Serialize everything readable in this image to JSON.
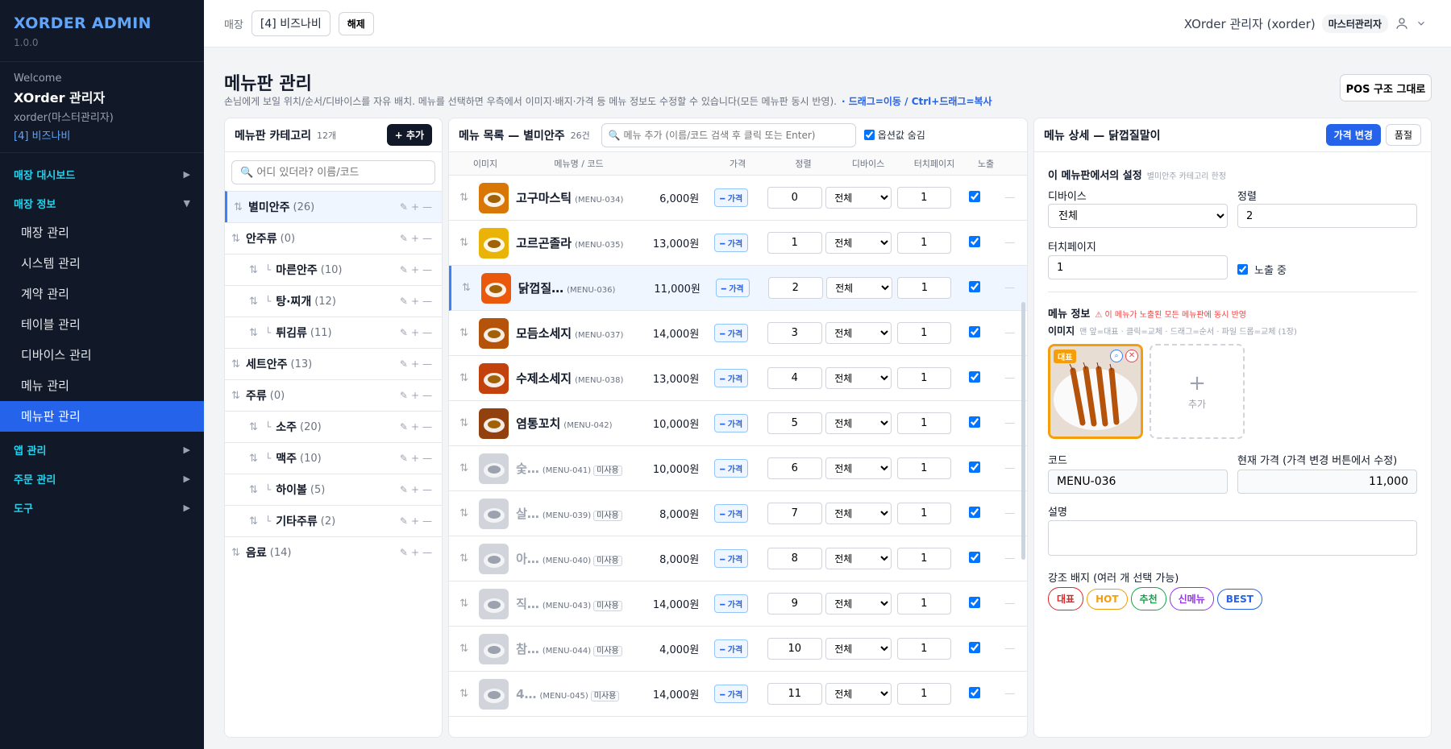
{
  "sidebar": {
    "brand": "XORDER ADMIN",
    "version": "1.0.0",
    "welcome": "Welcome",
    "user_name": "XOrder 관리자",
    "user_id": "xorder(마스터관리자)",
    "store": "[4] 비즈나비",
    "groups": {
      "dashboard": "매장 대시보드",
      "store_info": "매장 정보",
      "app": "앱 관리",
      "order": "주문 관리",
      "tools": "도구"
    },
    "items": [
      "매장 관리",
      "시스템 관리",
      "계약 관리",
      "테이블 관리",
      "디바이스 관리",
      "메뉴 관리",
      "메뉴판 관리"
    ]
  },
  "topbar": {
    "store_label": "매장",
    "store_value": "[4] 비즈나비",
    "release_label": "해제",
    "user": "XOrder 관리자 (xorder)",
    "role": "마스터관리자"
  },
  "page": {
    "title": "메뉴판 관리",
    "desc": "손님에게 보일 위치/순서/디바이스를 자유 배치. 메뉴를 선택하면 우측에서 이미지·배지·가격 등 메뉴 정보도 수정할 수 있습니다(모든 메뉴판 동시 반영).",
    "hint": "· 드래그=이동 / Ctrl+드래그=복사",
    "pos_button": "POS 구조 그대로"
  },
  "categories": {
    "title": "메뉴판 카테고리",
    "count": "12개",
    "add_label": "+ 추가",
    "search_placeholder": "🔍 어디 있더라? 이름/코드",
    "rows": [
      {
        "name": "별미안주",
        "count": "(26)"
      },
      {
        "name": "안주류",
        "count": "(0)"
      },
      {
        "name": "마른안주",
        "count": "(10)"
      },
      {
        "name": "탕·찌개",
        "count": "(12)"
      },
      {
        "name": "튀김류",
        "count": "(11)"
      },
      {
        "name": "세트안주",
        "count": "(13)"
      },
      {
        "name": "주류",
        "count": "(0)"
      },
      {
        "name": "소주",
        "count": "(20)"
      },
      {
        "name": "맥주",
        "count": "(10)"
      },
      {
        "name": "하이볼",
        "count": "(5)"
      },
      {
        "name": "기타주류",
        "count": "(2)"
      },
      {
        "name": "음료",
        "count": "(14)"
      }
    ]
  },
  "menu_list": {
    "title": "메뉴 목록 — 별미안주",
    "count": "26건",
    "search_placeholder": "🔍 메뉴 추가 (이름/코드 검색 후 클릭 또는 Enter)",
    "hide_option_label": "옵션값 숨김",
    "columns": [
      "이미지",
      "메뉴명 / 코드",
      "가격",
      "정렬",
      "디바이스",
      "터치페이지",
      "노출"
    ],
    "price_btn": "━ 가격",
    "unused_label": "미사용",
    "device_option": "전체",
    "rows": [
      {
        "name": "고구마스틱",
        "code": "(MENU-034)",
        "price": "6,000원",
        "sort": "0",
        "touch": "1"
      },
      {
        "name": "고르곤졸라",
        "code": "(MENU-035)",
        "price": "13,000원",
        "sort": "1",
        "touch": "1"
      },
      {
        "name": "닭껍질…",
        "code": "(MENU-036)",
        "price": "11,000원",
        "sort": "2",
        "touch": "1"
      },
      {
        "name": "모듬소세지",
        "code": "(MENU-037)",
        "price": "14,000원",
        "sort": "3",
        "touch": "1"
      },
      {
        "name": "수제소세지",
        "code": "(MENU-038)",
        "price": "13,000원",
        "sort": "4",
        "touch": "1"
      },
      {
        "name": "염통꼬치",
        "code": "(MENU-042)",
        "price": "10,000원",
        "sort": "5",
        "touch": "1"
      },
      {
        "name": "숯…",
        "code": "(MENU-041)",
        "price": "10,000원",
        "sort": "6",
        "touch": "1"
      },
      {
        "name": "살…",
        "code": "(MENU-039)",
        "price": "8,000원",
        "sort": "7",
        "touch": "1"
      },
      {
        "name": "아…",
        "code": "(MENU-040)",
        "price": "8,000원",
        "sort": "8",
        "touch": "1"
      },
      {
        "name": "직…",
        "code": "(MENU-043)",
        "price": "14,000원",
        "sort": "9",
        "touch": "1"
      },
      {
        "name": "참…",
        "code": "(MENU-044)",
        "price": "4,000원",
        "sort": "10",
        "touch": "1"
      },
      {
        "name": "4…",
        "code": "(MENU-045)",
        "price": "14,000원",
        "sort": "11",
        "touch": "1"
      }
    ]
  },
  "detail": {
    "title": "메뉴 상세 — 닭껍질말이",
    "price_change": "가격 변경",
    "soldout": "품절",
    "section1": "이 메뉴판에서의 설정",
    "section1_sub": "별미안주 카테고리 한정",
    "device_label": "디바이스",
    "device_value": "전체",
    "sort_label": "정렬",
    "sort_value": "2",
    "touch_label": "터치페이지",
    "touch_value": "1",
    "visible_label": "노출 중",
    "section2": "메뉴 정보",
    "section2_warn": "⚠ 이 메뉴가 노출된 모든 메뉴판에 동시 반영",
    "image_label": "이미지",
    "image_hint": "맨 앞=대표 · 클릭=교체 · 드래그=순서 · 파일 드롭=교체 (1장)",
    "main_badge": "대표",
    "add_image": "추가",
    "code_label": "코드",
    "code_value": "MENU-036",
    "price_label": "현재 가격 (가격 변경 버튼에서 수정)",
    "price_value": "11,000",
    "desc_label": "설명",
    "badge_label": "강조 배지 (여러 개 선택 가능)",
    "badges": [
      "대표",
      "HOT",
      "추천",
      "신메뉴",
      "BEST"
    ],
    "badge_colors": [
      "#dc2626",
      "#f59e0b",
      "#16a34a",
      "#9333ea",
      "#2563eb"
    ]
  }
}
